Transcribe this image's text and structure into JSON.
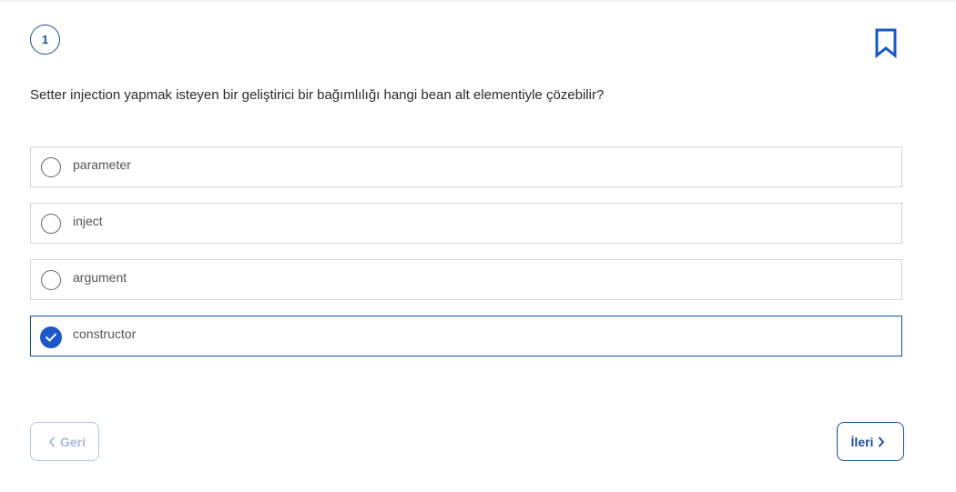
{
  "question": {
    "number": "1",
    "text": "Setter injection yapmak isteyen bir geliştirici bir bağımlılığı hangi bean alt elementiyle çözebilir?"
  },
  "options": [
    {
      "label": "parameter",
      "selected": false
    },
    {
      "label": "inject",
      "selected": false
    },
    {
      "label": "argument",
      "selected": false
    },
    {
      "label": "constructor",
      "selected": true
    }
  ],
  "nav": {
    "back_label": "Geri",
    "next_label": "İleri",
    "back_icon": "chevron-left-icon",
    "next_icon": "chevron-right-icon"
  },
  "icons": {
    "bookmark": "bookmark-icon",
    "check": "check-icon"
  },
  "colors": {
    "accent": "#1b4f9c",
    "selected_radio": "#1958c6",
    "disabled": "#a7bbdc"
  }
}
